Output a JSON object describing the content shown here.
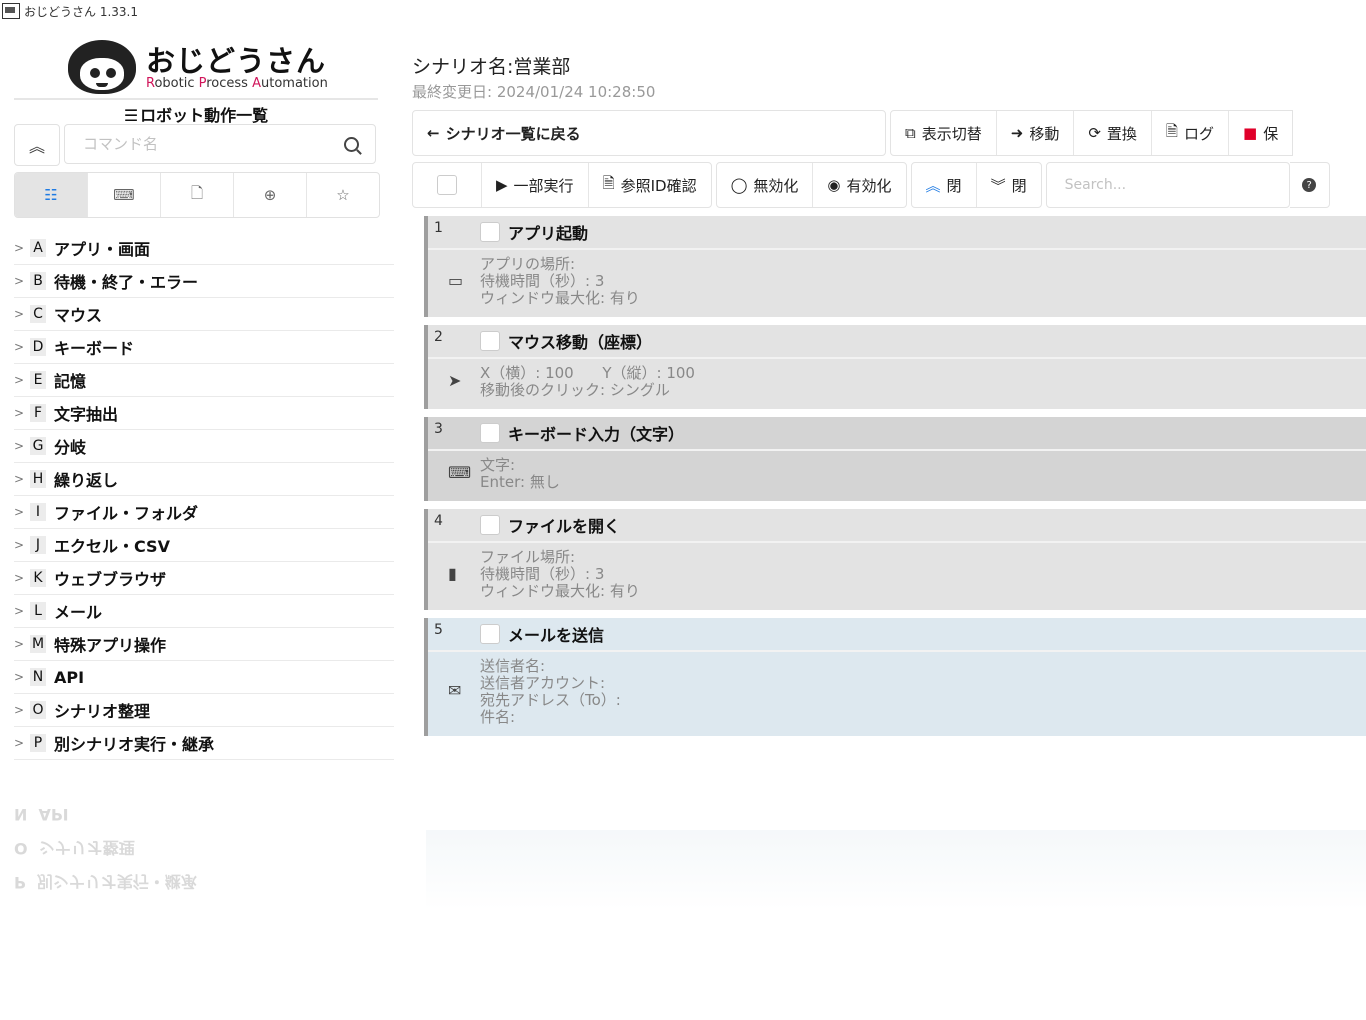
{
  "window": {
    "title": "おじどうさん 1.33.1"
  },
  "logo": {
    "title": "おじどうさん",
    "sub_r1": "R",
    "sub_1": "obotic ",
    "sub_r2": "P",
    "sub_2": "rocess ",
    "sub_r3": "A",
    "sub_3": "utomation"
  },
  "sidebar": {
    "list_title": "ロボット動作一覧",
    "search_placeholder": "コマンド名",
    "tabs": [
      "list-icon",
      "keyboard-icon",
      "file-icon",
      "globe-icon",
      "star-icon"
    ],
    "categories": [
      {
        "letter": "A",
        "label": "アプリ・画面"
      },
      {
        "letter": "B",
        "label": "待機・終了・エラー"
      },
      {
        "letter": "C",
        "label": "マウス"
      },
      {
        "letter": "D",
        "label": "キーボード"
      },
      {
        "letter": "E",
        "label": "記憶"
      },
      {
        "letter": "F",
        "label": "文字抽出"
      },
      {
        "letter": "G",
        "label": "分岐"
      },
      {
        "letter": "H",
        "label": "繰り返し"
      },
      {
        "letter": "I",
        "label": "ファイル・フォルダ"
      },
      {
        "letter": "J",
        "label": "エクセル・CSV"
      },
      {
        "letter": "K",
        "label": "ウェブブラウザ"
      },
      {
        "letter": "L",
        "label": "メール"
      },
      {
        "letter": "M",
        "label": "特殊アプリ操作"
      },
      {
        "letter": "N",
        "label": "API"
      },
      {
        "letter": "O",
        "label": "シナリオ整理"
      },
      {
        "letter": "P",
        "label": "別シナリオ実行・継承"
      }
    ]
  },
  "main": {
    "scenario_title": "シナリオ名:営業部",
    "last_modified": "最終変更日: 2024/01/24 10:28:50",
    "toolbar1": {
      "back": "シナリオ一覧に戻る",
      "display_switch": "表示切替",
      "move": "移動",
      "replace": "置換",
      "log": "ログ",
      "save": "保"
    },
    "toolbar2": {
      "partial_run": "一部実行",
      "ref_id": "参照ID確認",
      "disable": "無効化",
      "enable": "有効化",
      "close_up": "閉",
      "close_down": "閉",
      "search_placeholder": "Search..."
    },
    "commands": [
      {
        "num": "1",
        "title": "アプリ起動",
        "icon": "window-icon",
        "lines": [
          "アプリの場所:",
          "待機時間（秒）: 3",
          "ウィンドウ最大化: 有り"
        ]
      },
      {
        "num": "2",
        "title": "マウス移動（座標）",
        "icon": "cursor-icon",
        "lines": [
          "X（横）: 100      Y（縦）: 100",
          "移動後のクリック: シングル"
        ]
      },
      {
        "num": "3",
        "title": "キーボード入力（文字）",
        "icon": "keyboard-icon",
        "lines": [
          "文字:",
          "Enter: 無し"
        ]
      },
      {
        "num": "4",
        "title": "ファイルを開く",
        "icon": "document-icon",
        "lines": [
          "ファイル場所:",
          "待機時間（秒）: 3",
          "ウィンドウ最大化: 有り"
        ]
      },
      {
        "num": "5",
        "title": "メールを送信",
        "icon": "mail-icon",
        "lines": [
          "送信者名:",
          "送信者アカウント:",
          "宛先アドレス（To）:",
          "件名:"
        ]
      }
    ]
  },
  "colors": {
    "accent": "#1f7be3",
    "logo_red": "#d0155a",
    "save_red": "#e0002a",
    "card_gray": "#e3e3e3",
    "card_mail": "#dde8ef"
  }
}
